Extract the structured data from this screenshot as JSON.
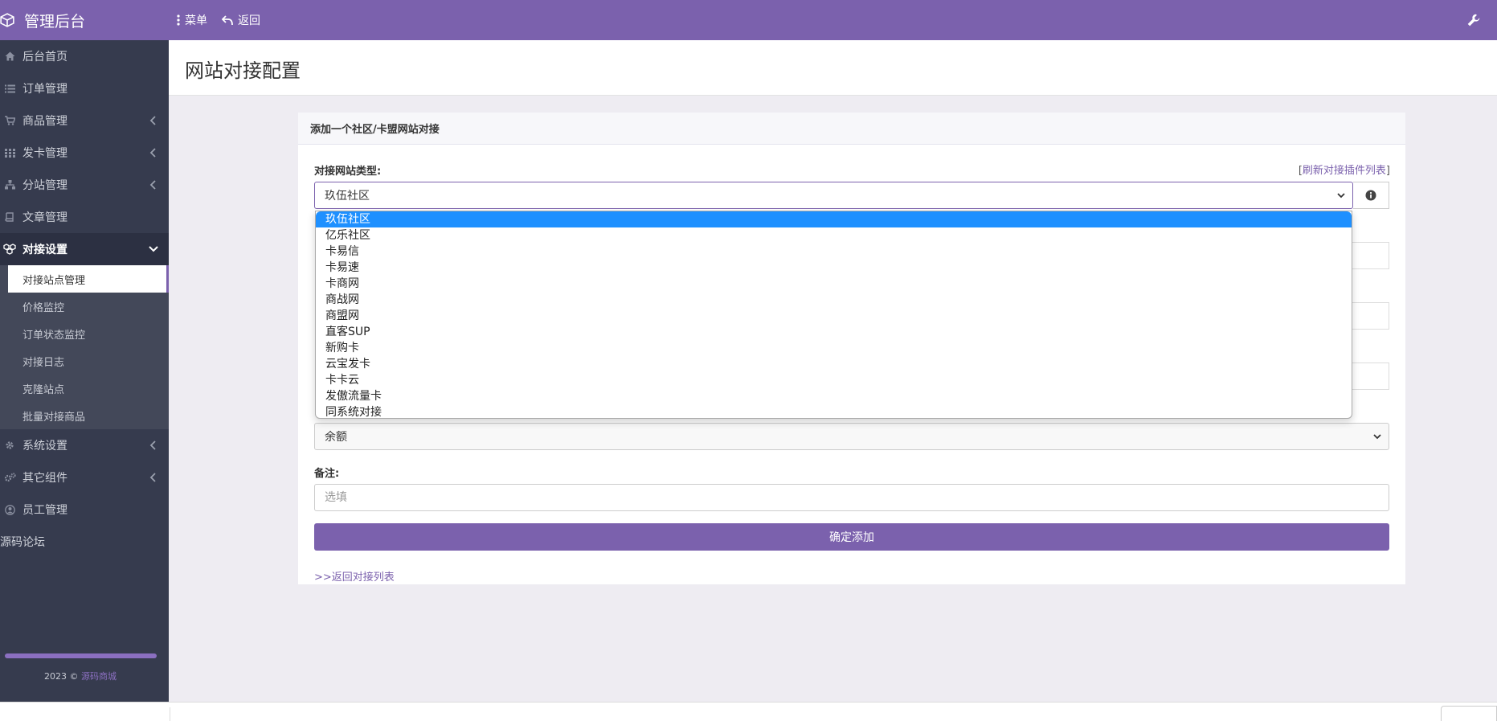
{
  "app": {
    "brand": "管理后台"
  },
  "topnav": {
    "menu_label": "菜单",
    "back_label": "返回"
  },
  "sidebar": {
    "items": [
      {
        "label": "后台首页"
      },
      {
        "label": "订单管理"
      },
      {
        "label": "商品管理"
      },
      {
        "label": "发卡管理"
      },
      {
        "label": "分站管理"
      },
      {
        "label": "文章管理"
      },
      {
        "label": "对接设置"
      }
    ],
    "sub_items": [
      {
        "label": "对接站点管理"
      },
      {
        "label": "价格监控"
      },
      {
        "label": "订单状态监控"
      },
      {
        "label": "对接日志"
      },
      {
        "label": "克隆站点"
      },
      {
        "label": "批量对接商品"
      }
    ],
    "items_after": [
      {
        "label": "系统设置"
      },
      {
        "label": "其它组件"
      },
      {
        "label": "员工管理"
      }
    ],
    "forum": "源码论坛",
    "footer_year": "2023 ©",
    "footer_link": "源码商城"
  },
  "page": {
    "title": "网站对接配置"
  },
  "panel": {
    "heading": "添加一个社区/卡盟网站对接",
    "type_label": "对接网站类型:",
    "refresh_open": "[",
    "refresh_link": "刷新对接插件列表",
    "refresh_close": "]",
    "selected_type": "玖伍社区",
    "options": [
      "玖伍社区",
      "亿乐社区",
      "卡易信",
      "卡易速",
      "卡商网",
      "商战网",
      "商盟网",
      "直客SUP",
      "新购卡",
      "云宝发卡",
      "卡卡云",
      "发傲流量卡",
      "同系统对接"
    ],
    "balance_select": "余额",
    "note_label": "备注:",
    "note_placeholder": "选填",
    "submit_label": "确定添加",
    "back_link": ">>返回对接列表"
  },
  "colors": {
    "accent": "#7b61ad",
    "sidebar_bg": "#363b4e",
    "option_highlight": "#1e90ff"
  }
}
